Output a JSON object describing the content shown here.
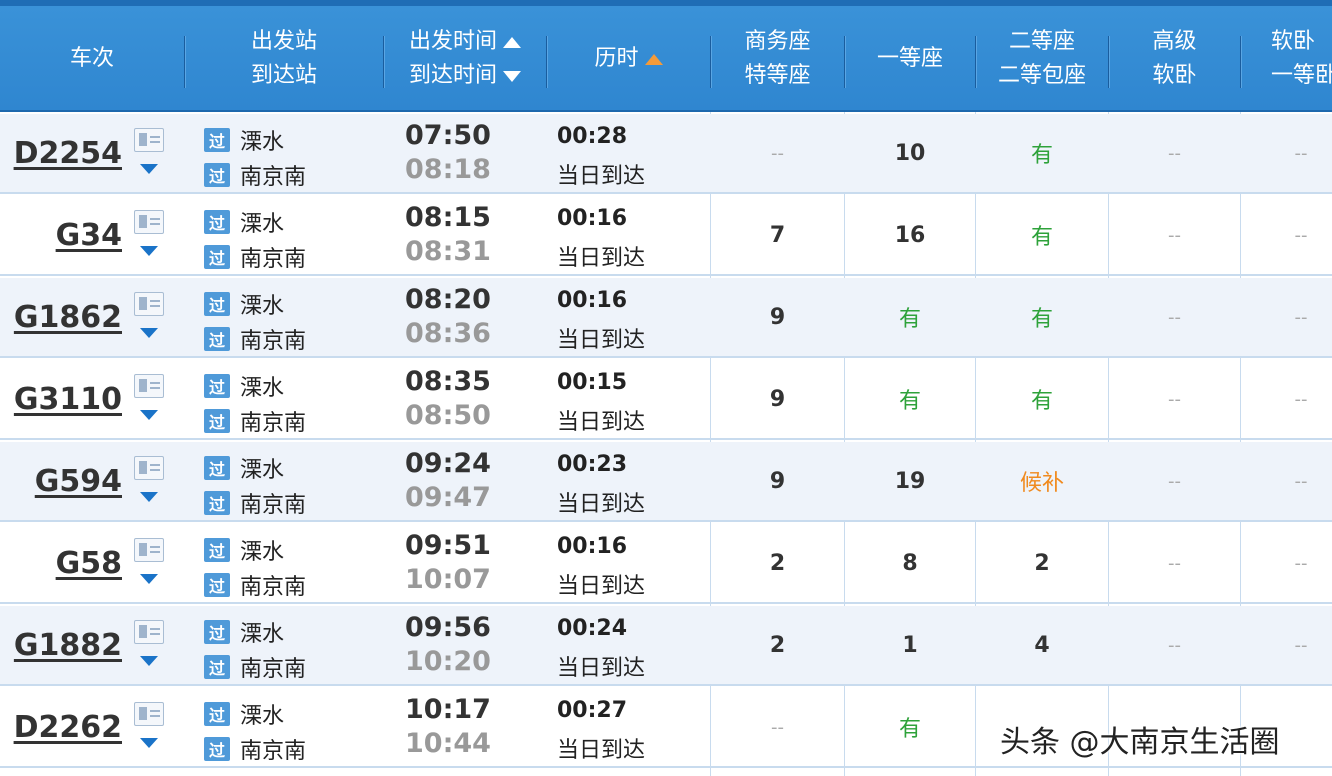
{
  "header": {
    "train_no": "车次",
    "depart_station": "出发站",
    "arrive_station": "到达站",
    "depart_time": "出发时间",
    "arrive_time": "到达时间",
    "duration": "历时",
    "business_line1": "商务座",
    "business_line2": "特等座",
    "first_class": "一等座",
    "second_line1": "二等座",
    "second_line2": "二等包座",
    "advsoft_line1": "高级",
    "advsoft_line2": "软卧",
    "soft_line1": "软卧",
    "soft_line2": "一等卧"
  },
  "pass_badge": "过",
  "rows": [
    {
      "train": "D2254",
      "from": "溧水",
      "to": "南京南",
      "dep": "07:50",
      "arr": "08:18",
      "dur": "00:28",
      "day": "当日到达",
      "business": "--",
      "first": "10",
      "second": "有",
      "advsoft": "--",
      "soft": "--"
    },
    {
      "train": "G34",
      "from": "溧水",
      "to": "南京南",
      "dep": "08:15",
      "arr": "08:31",
      "dur": "00:16",
      "day": "当日到达",
      "business": "7",
      "first": "16",
      "second": "有",
      "advsoft": "--",
      "soft": "--"
    },
    {
      "train": "G1862",
      "from": "溧水",
      "to": "南京南",
      "dep": "08:20",
      "arr": "08:36",
      "dur": "00:16",
      "day": "当日到达",
      "business": "9",
      "first": "有",
      "second": "有",
      "advsoft": "--",
      "soft": "--"
    },
    {
      "train": "G3110",
      "from": "溧水",
      "to": "南京南",
      "dep": "08:35",
      "arr": "08:50",
      "dur": "00:15",
      "day": "当日到达",
      "business": "9",
      "first": "有",
      "second": "有",
      "advsoft": "--",
      "soft": "--"
    },
    {
      "train": "G594",
      "from": "溧水",
      "to": "南京南",
      "dep": "09:24",
      "arr": "09:47",
      "dur": "00:23",
      "day": "当日到达",
      "business": "9",
      "first": "19",
      "second": "候补",
      "advsoft": "--",
      "soft": "--"
    },
    {
      "train": "G58",
      "from": "溧水",
      "to": "南京南",
      "dep": "09:51",
      "arr": "10:07",
      "dur": "00:16",
      "day": "当日到达",
      "business": "2",
      "first": "8",
      "second": "2",
      "advsoft": "--",
      "soft": "--"
    },
    {
      "train": "G1882",
      "from": "溧水",
      "to": "南京南",
      "dep": "09:56",
      "arr": "10:20",
      "dur": "00:24",
      "day": "当日到达",
      "business": "2",
      "first": "1",
      "second": "4",
      "advsoft": "--",
      "soft": "--"
    },
    {
      "train": "D2262",
      "from": "溧水",
      "to": "南京南",
      "dep": "10:17",
      "arr": "10:44",
      "dur": "00:27",
      "day": "当日到达",
      "business": "--",
      "first": "有",
      "second": "",
      "advsoft": "",
      "soft": ""
    }
  ],
  "watermark": "头条 @大南京生活圈",
  "colors": {
    "header_bg": "#3a92d8",
    "available": "#2ea23a",
    "waitlist": "#f08a1e",
    "alt_row": "#eef3fa"
  }
}
